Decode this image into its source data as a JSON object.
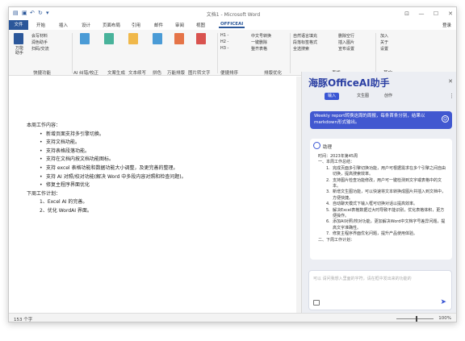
{
  "window": {
    "title": "文档1 - Microsoft Word"
  },
  "tabs": [
    "文件",
    "开始",
    "插入",
    "设计",
    "页面布局",
    "引用",
    "邮件",
    "审阅",
    "视图",
    "OFFICEAI"
  ],
  "login": "登录",
  "ribbon": {
    "wanneng": "万能\n助手",
    "items1": [
      "会写材料",
      "润色助手",
      "扫码/交流"
    ],
    "items2": [
      "H1 -",
      "H2 -",
      "H3 -"
    ],
    "items3": [
      "中文号转换",
      "一键删除",
      "整齐表格"
    ],
    "items4": [
      "自然语言填充",
      "段落标签格式",
      "全选搜索",
      "空格自选"
    ],
    "items5": [
      "删除空行",
      "插入图片",
      "宣布设置"
    ],
    "items6": [
      "加入",
      "关于",
      "设置"
    ],
    "groups": [
      "快捷功能",
      "AI 纠错/校正",
      "文案生成",
      "文本续写",
      "拼色",
      "万能排版",
      "图片转文字",
      "便捷排序",
      "排版优化",
      "表格",
      "其它"
    ]
  },
  "doc": {
    "heading1": "本周工作内容：",
    "items1": [
      "新增页面支持多引擎切换。",
      "支持文档功能。",
      "支持表格段落功能。",
      "支持在文档内按文档功能图标。",
      "支持 excel 表格功能和数据功能大小调整，及更完善的整理。",
      "支持 AI 对照/校对功能(解决 Word 中多段内容对照和检查问题)。",
      "修复主程序界面优化"
    ],
    "heading2": "下周工作计划：",
    "items2": [
      "1、Excel AI 的完善。",
      "2、优化 WordAI 界面。"
    ]
  },
  "panel": {
    "title": "海豚OfficeAI助手",
    "tabs": [
      "输入",
      "文生图",
      "创作"
    ],
    "user_msg": "Weekly report转换这周的周报，每条首条分别，结果以markdown形式输出。",
    "ai_name": "助理",
    "ai_date": "时间：2023年第45周",
    "ai_section": "一、本周工作总结：",
    "ai_items": [
      "完成页面多引擎切换功能，用户可根据需求在多个引擎之间自由切换，提高搜索效率。",
      "支持图片检查功能修改，用户可一键检测到文字或表格中的文本。",
      "新增文生图功能，可以快速将文本转换成图片并插入到文档中，方便快捷。",
      "自动聊天模式下输入框可切换对话以提高效率。",
      "解决Excel表格数据过大时导致不能识别，优化表格体积，更方便操作。",
      "添加AI对照/校对功能，更加解决Word中文档字号差异问题，提高文字准确性。",
      "修复主程序界面优化问题，提升产品使用体验。"
    ],
    "ai_more": "二、下周工作计划：",
    "input_placeholder": "可以 请问我想入里面的字符，请在框中发出来的功能的"
  },
  "status": {
    "words": "153 个字",
    "zoom": "100%"
  }
}
